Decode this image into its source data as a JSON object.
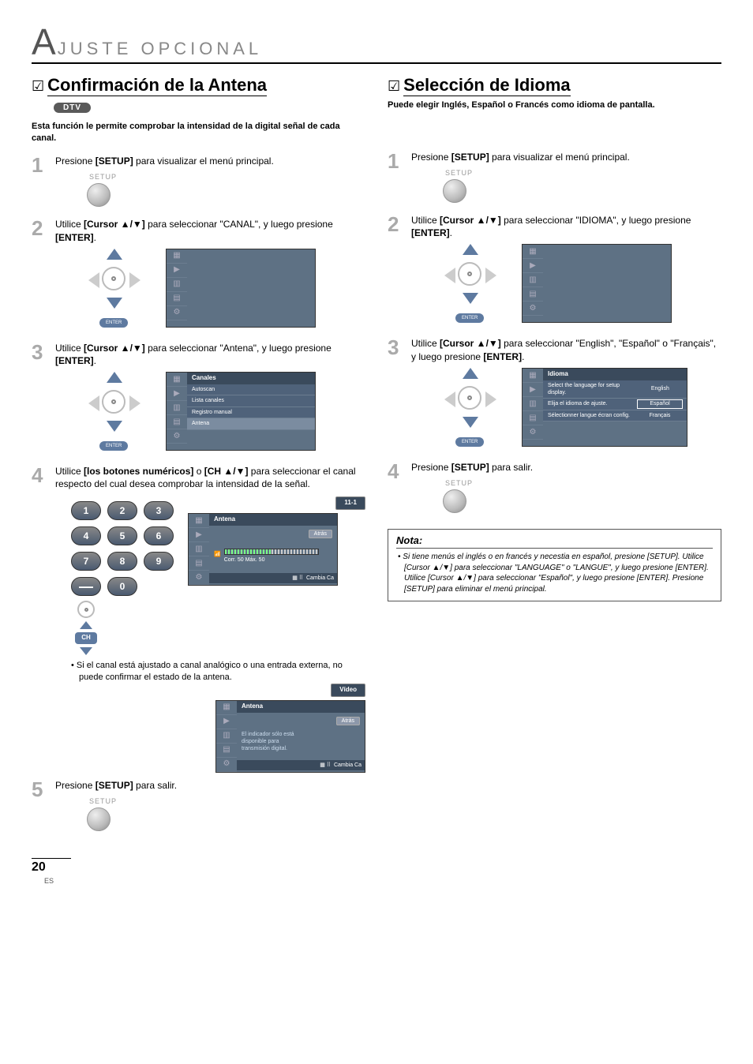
{
  "page_header": {
    "first_letter": "A",
    "rest": "JUSTE  OPCIONAL"
  },
  "left": {
    "title": "Confirmación de la Antena",
    "badge": "DTV",
    "intro": "Esta función le permite comprobar la intensidad de la digital señal de cada canal.",
    "step1": {
      "text_before": "Presione ",
      "bold1": "[SETUP]",
      "text_after": " para visualizar el menú principal.",
      "setup_label": "SETUP"
    },
    "step2": {
      "t1": "Utilice ",
      "b1": "[Cursor ▲/▼]",
      "t2": " para seleccionar \"CANAL\", y luego presione ",
      "b2": "[ENTER]",
      "t3": "."
    },
    "step3": {
      "t1": "Utilice ",
      "b1": "[Cursor ▲/▼]",
      "t2": " para seleccionar \"Antena\", y luego presione ",
      "b2": "[ENTER]",
      "t3": ".",
      "osd_header": "Canales",
      "osd_items": [
        "Autoscan",
        "Lista canales",
        "Registro manual",
        "Antena"
      ]
    },
    "step4": {
      "t1": "Utilice ",
      "b1": "[los botones numéricos]",
      "t2": " o ",
      "b2": "[CH ▲/▼]",
      "t3": " para seleccionar el canal respecto del cual desea comprobar la intensidad de la señal.",
      "keys": [
        "1",
        "2",
        "3",
        "4",
        "5",
        "6",
        "7",
        "8",
        "9",
        "—",
        "0"
      ],
      "ch_label": "CH",
      "channel_indicator": "11-1",
      "osd_header": "Antena",
      "back_label": "Atrás",
      "meter_label": "Corr.  50   Máx.   50",
      "foot": "Cambia Ca",
      "bullet": "Si el canal está ajustado a canal analógico o una entrada externa, no puede confirmar el estado de la antena.",
      "video_label": "Vídeo",
      "osd2_header": "Antena",
      "osd2_back": "Atrás",
      "osd2_msg1": "El indicador sólo está",
      "osd2_msg2": "disponible para",
      "osd2_msg3": "transmisión digital.",
      "osd2_foot": "Cambia Ca"
    },
    "step5": {
      "t1": "Presione ",
      "b1": "[SETUP]",
      "t2": " para salir.",
      "setup_label": "SETUP"
    }
  },
  "right": {
    "title": "Selección de Idioma",
    "intro": "Puede elegir Inglés, Español o Francés como idioma de pantalla.",
    "step1": {
      "text_before": "Presione ",
      "bold1": "[SETUP]",
      "text_after": " para visualizar el menú principal.",
      "setup_label": "SETUP"
    },
    "step2": {
      "t1": "Utilice ",
      "b1": "[Cursor ▲/▼]",
      "t2": " para seleccionar \"IDIOMA\", y luego presione ",
      "b2": "[ENTER]",
      "t3": "."
    },
    "step3": {
      "t1": "Utilice ",
      "b1": "[Cursor ▲/▼]",
      "t2": " para seleccionar \"English\", \"Español\" o \"Français\", y luego presione ",
      "b2": "[ENTER]",
      "t3": ".",
      "osd_header": "Idioma",
      "rows": [
        {
          "label": "Select the language for setup display.",
          "lang": "English"
        },
        {
          "label": "Elija el idioma de ajuste.",
          "lang": "Español"
        },
        {
          "label": "Sélectionner langue écran config.",
          "lang": "Français"
        }
      ]
    },
    "step4": {
      "t1": "Presione ",
      "b1": "[SETUP]",
      "t2": " para salir.",
      "setup_label": "SETUP"
    },
    "note": {
      "head": "Nota:",
      "body": "• Si tiene menús el inglés o en francés y necestia en español, presione [SETUP]. Utilice [Cursor ▲/▼] para seleccionar \"LANGUAGE\" o \"LANGUE\", y luego presione [ENTER]. Utilice [Cursor ▲/▼] para seleccionar \"Español\", y luego presione [ENTER]. Presione [SETUP] para eliminar el menú principal."
    }
  },
  "enter_label": "ENTER",
  "footer": {
    "page": "20",
    "lang": "ES"
  }
}
